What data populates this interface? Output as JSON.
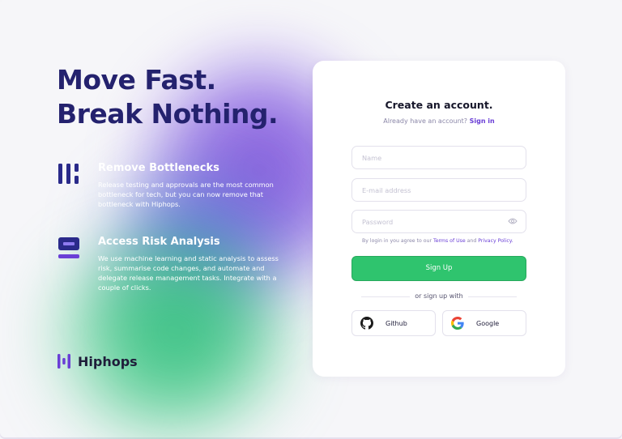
{
  "hero": {
    "line1": "Move Fast.",
    "line2": "Break Nothing."
  },
  "features": [
    {
      "title": "Remove Bottlenecks",
      "description": "Release testing and approvals are the most common bottleneck for tech, but you can now remove that bottleneck with Hiphops.",
      "icon": "bottleneck-bars-icon"
    },
    {
      "title": "Access Risk Analysis",
      "description": "We use machine learning and static analysis to assess risk, summarise code changes, and automate and delegate release management tasks. Integrate with a couple of clicks.",
      "icon": "risk-analysis-icon"
    }
  ],
  "brand": {
    "name": "Hiphops",
    "logo": "hiphops-logo-icon"
  },
  "form": {
    "title": "Create an account.",
    "subtitle": "Already have an account?",
    "signin_link": "Sign in",
    "name_placeholder": "Name",
    "email_placeholder": "E-mail address",
    "password_placeholder": "Password",
    "terms_prefix": "By login in you agree to our",
    "terms_link": "Terms of Use",
    "terms_and": "and",
    "privacy_link": "Privacy Policy.",
    "signup_label": "Sign Up",
    "divider_text": "or sign up with",
    "github_label": "Github",
    "google_label": "Google"
  },
  "colors": {
    "heading": "#24226e",
    "accent": "#6a3fd6",
    "button": "#2fc46e",
    "background": "#f6f6f9"
  }
}
